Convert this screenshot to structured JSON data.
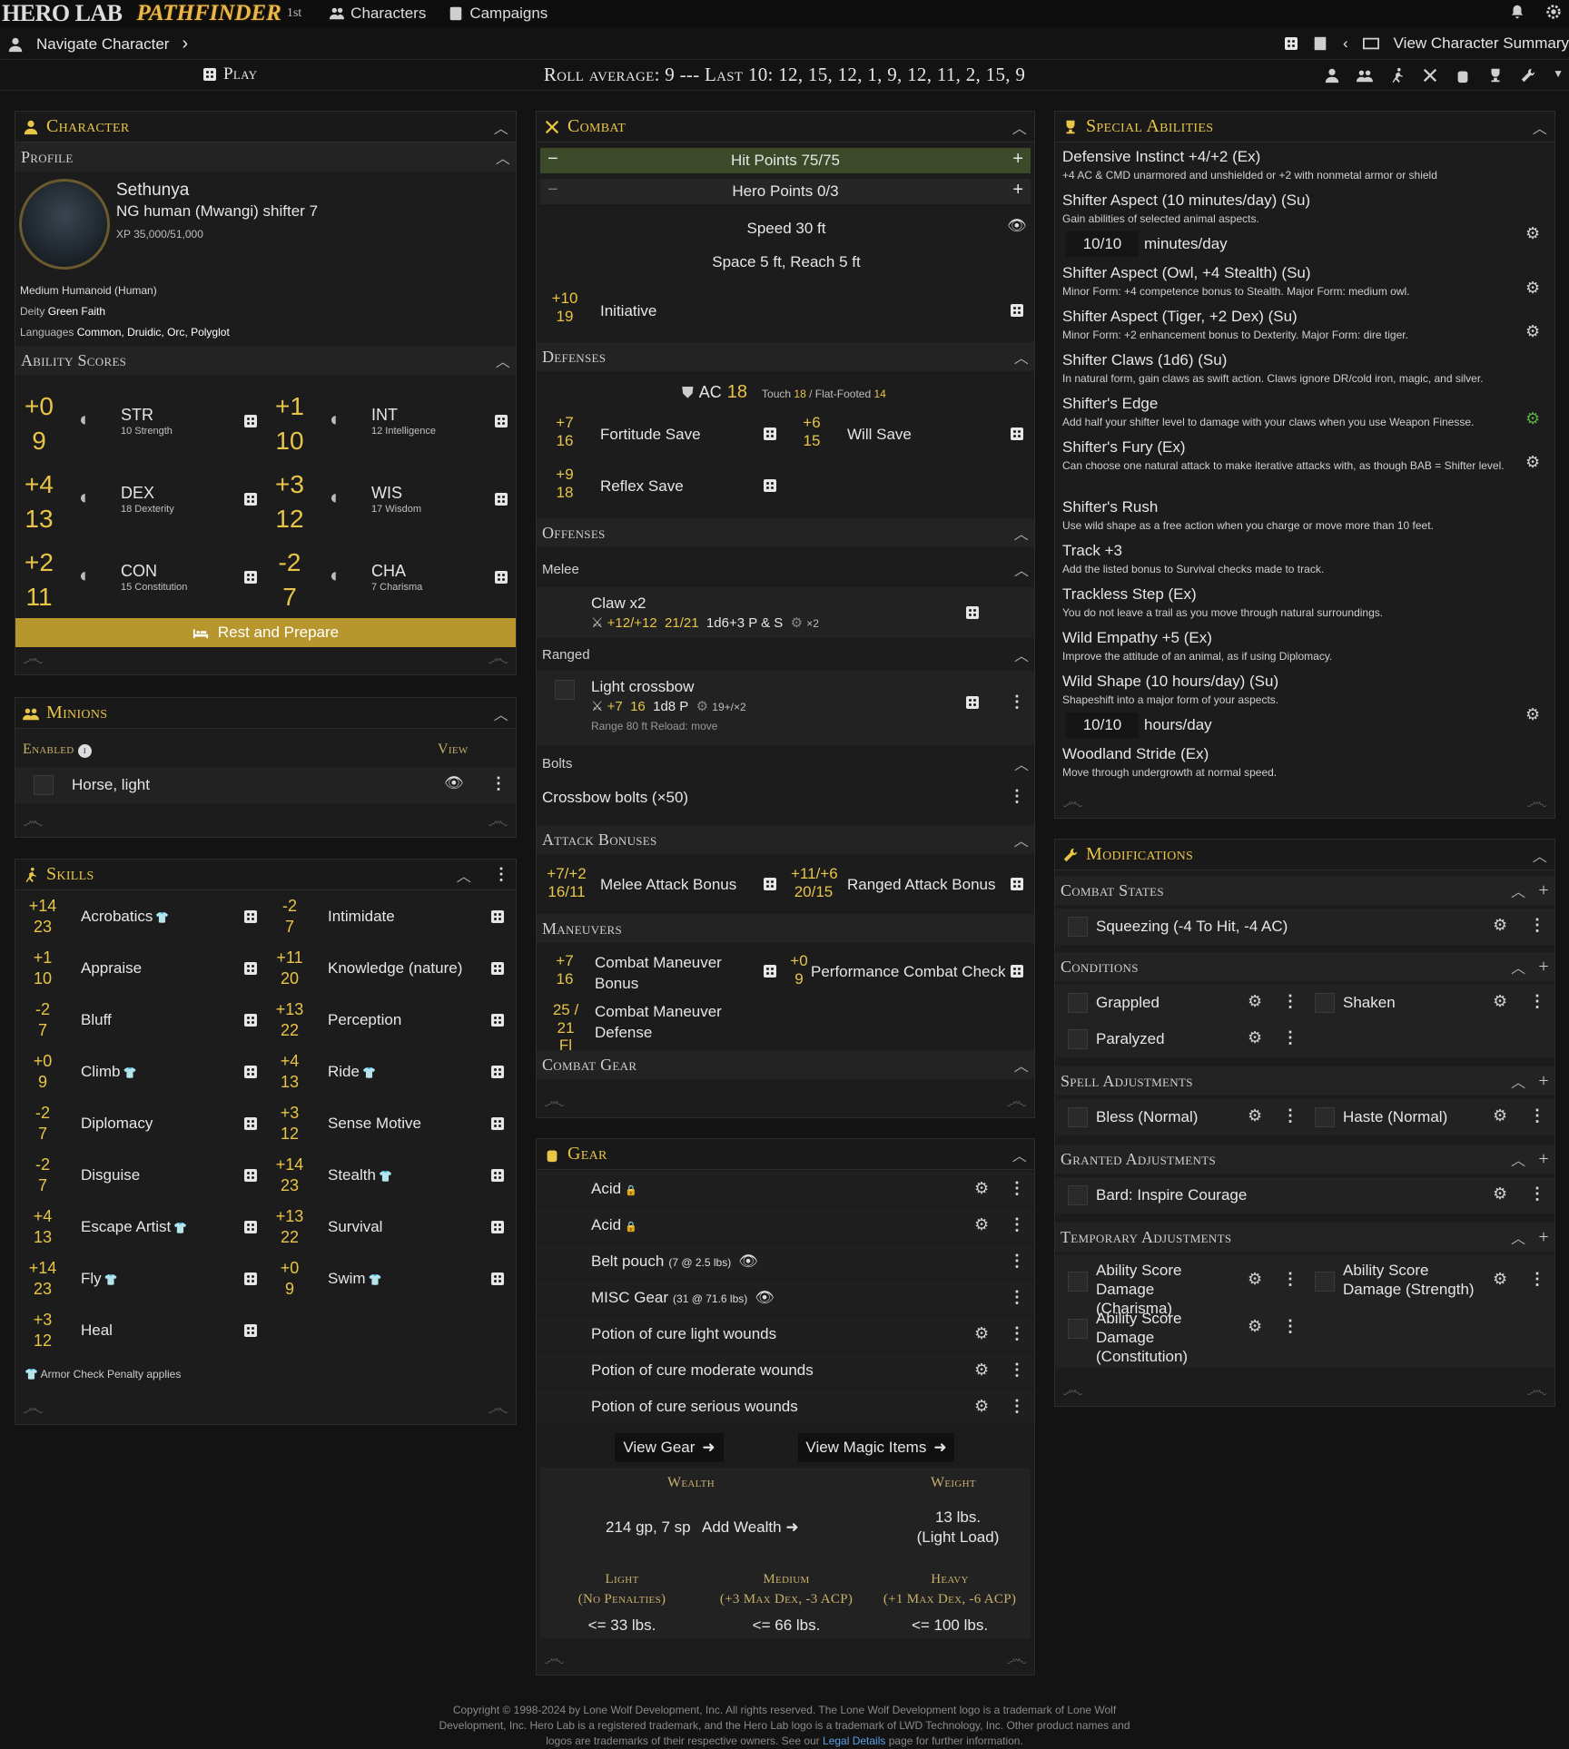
{
  "topbar": {
    "logo": "HERO LAB",
    "pathfinder": "PATHFINDER",
    "edition": "1st",
    "nav_characters": "Characters",
    "nav_campaigns": "Campaigns"
  },
  "bar2": {
    "navigate": "Navigate Character",
    "view_summary": "View Character Summary"
  },
  "bar3": {
    "play": "Play",
    "roll": "Roll average: 9 --- Last 10: 12, 15, 12, 1, 9, 12, 11, 2, 15, 9"
  },
  "character": {
    "title": "Character",
    "profile": "Profile",
    "name": "Sethunya",
    "desc": "NG human (Mwangi) shifter 7",
    "xp": "XP 35,000/51,000",
    "size": "Medium Humanoid (Human)",
    "deity_label": "Deity",
    "deity": "Green Faith",
    "lang_label": "Languages",
    "languages": "Common, Druidic, Orc, Polyglot",
    "ability_title": "Ability Scores",
    "abilities": [
      {
        "mod": "+0",
        "score": "9",
        "abbr": "STR",
        "full": "10 Strength"
      },
      {
        "mod": "+1",
        "score": "10",
        "abbr": "INT",
        "full": "12 Intelligence"
      },
      {
        "mod": "+4",
        "score": "13",
        "abbr": "DEX",
        "full": "18 Dexterity"
      },
      {
        "mod": "+3",
        "score": "12",
        "abbr": "WIS",
        "full": "17 Wisdom"
      },
      {
        "mod": "+2",
        "score": "11",
        "abbr": "CON",
        "full": "15 Constitution"
      },
      {
        "mod": "-2",
        "score": "7",
        "abbr": "CHA",
        "full": "7 Charisma"
      }
    ],
    "rest": "Rest and Prepare"
  },
  "minions": {
    "title": "Minions",
    "enabled": "Enabled",
    "view": "View",
    "item": "Horse, light"
  },
  "skills": {
    "title": "Skills",
    "acp_note": "Armor Check Penalty applies",
    "left": [
      {
        "mod": "+14",
        "total": "23",
        "name": "Acrobatics",
        "acp": true
      },
      {
        "mod": "+1",
        "total": "10",
        "name": "Appraise",
        "acp": false
      },
      {
        "mod": "-2",
        "total": "7",
        "name": "Bluff",
        "acp": false
      },
      {
        "mod": "+0",
        "total": "9",
        "name": "Climb",
        "acp": true
      },
      {
        "mod": "-2",
        "total": "7",
        "name": "Diplomacy",
        "acp": false
      },
      {
        "mod": "-2",
        "total": "7",
        "name": "Disguise",
        "acp": false
      },
      {
        "mod": "+4",
        "total": "13",
        "name": "Escape Artist",
        "acp": true
      },
      {
        "mod": "+14",
        "total": "23",
        "name": "Fly",
        "acp": true
      },
      {
        "mod": "+3",
        "total": "12",
        "name": "Heal",
        "acp": false
      }
    ],
    "right": [
      {
        "mod": "-2",
        "total": "7",
        "name": "Intimidate",
        "acp": false
      },
      {
        "mod": "+11",
        "total": "20",
        "name": "Knowledge (nature)",
        "acp": false
      },
      {
        "mod": "+13",
        "total": "22",
        "name": "Perception",
        "acp": false
      },
      {
        "mod": "+4",
        "total": "13",
        "name": "Ride",
        "acp": true
      },
      {
        "mod": "+3",
        "total": "12",
        "name": "Sense Motive",
        "acp": false
      },
      {
        "mod": "+14",
        "total": "23",
        "name": "Stealth",
        "acp": true
      },
      {
        "mod": "+13",
        "total": "22",
        "name": "Survival",
        "acp": false
      },
      {
        "mod": "+0",
        "total": "9",
        "name": "Swim",
        "acp": true
      }
    ]
  },
  "combat": {
    "title": "Combat",
    "hp": "Hit Points 75/75",
    "hero": "Hero Points 0/3",
    "speed": "Speed 30 ft",
    "space": "Space 5 ft, Reach 5 ft",
    "init_mod": "+10",
    "init_total": "19",
    "init_label": "Initiative",
    "defenses_title": "Defenses",
    "ac_label": "AC",
    "ac": "18",
    "touch_label": "Touch",
    "touch": "18",
    "ff_label": "/ Flat-Footed",
    "ff": "14",
    "fort": {
      "mod": "+7",
      "total": "16",
      "label": "Fortitude Save"
    },
    "will": {
      "mod": "+6",
      "total": "15",
      "label": "Will Save"
    },
    "reflex": {
      "mod": "+9",
      "total": "18",
      "label": "Reflex Save"
    },
    "offenses_title": "Offenses",
    "melee_title": "Melee",
    "claw": {
      "name": "Claw x2",
      "attack": "+12/+12",
      "uses": "21/21",
      "dmg": "1d6+3 P & S",
      "crit": "×2"
    },
    "ranged_title": "Ranged",
    "crossbow": {
      "name": "Light crossbow",
      "attack": "+7",
      "total": "16",
      "dmg": "1d8 P",
      "crit": "19+/×2",
      "range": "Range 80 ft Reload: move"
    },
    "bolts_title": "Bolts",
    "bolts": "Crossbow bolts (×50)",
    "attack_title": "Attack Bonuses",
    "melee_ab": {
      "mod": "+7/+2",
      "total": "16/11",
      "label": "Melee Attack Bonus"
    },
    "ranged_ab": {
      "mod": "+11/+6",
      "total": "20/15",
      "label": "Ranged Attack Bonus"
    },
    "maneuvers_title": "Maneuvers",
    "cmb": {
      "mod": "+7",
      "total": "16",
      "label": "Combat Maneuver Bonus"
    },
    "pcc": {
      "mod": "+0",
      "total": "9",
      "label": "Performance Combat Check"
    },
    "cmd": {
      "mod": "25 / 21",
      "total": "Fl",
      "label": "Combat Maneuver Defense"
    },
    "combat_gear_title": "Combat Gear"
  },
  "gear": {
    "title": "Gear",
    "items": [
      {
        "name": "Acid",
        "extra": ""
      },
      {
        "name": "Acid",
        "extra": ""
      },
      {
        "name": "Belt pouch",
        "extra": "(7 @ 2.5 lbs)"
      },
      {
        "name": "MISC Gear",
        "extra": "(31 @ 71.6 lbs)"
      },
      {
        "name": "Potion of cure light wounds",
        "extra": ""
      },
      {
        "name": "Potion of cure moderate wounds",
        "extra": ""
      },
      {
        "name": "Potion of cure serious wounds",
        "extra": ""
      }
    ],
    "view_gear": "View Gear",
    "view_magic": "View Magic Items",
    "wealth_label": "Wealth",
    "weight_label": "Weight",
    "wealth": "214 gp, 7 sp",
    "add_wealth": "Add Wealth",
    "weight": "13 lbs.",
    "load": "(Light Load)",
    "light": "Light",
    "light_sub": "(No Penalties)",
    "medium": "Medium",
    "medium_sub": "(+3 Max Dex, -3 ACP)",
    "heavy": "Heavy",
    "heavy_sub": "(+1 Max Dex, -6 ACP)",
    "light_val": "<= 33 lbs.",
    "medium_val": "<= 66 lbs.",
    "heavy_val": "<= 100 lbs."
  },
  "special": {
    "title": "Special Abilities",
    "items": [
      {
        "name": "Defensive Instinct +4/+2 (Ex)",
        "desc": "+4 AC & CMD unarmored and unshielded or +2 with nonmetal armor or shield"
      },
      {
        "name": "Shifter Aspect (10 minutes/day) (Su)",
        "desc": "Gain abilities of selected animal aspects.",
        "counter": "10/10",
        "unit": "minutes/day"
      },
      {
        "name": "Shifter Aspect (Owl, +4 Stealth) (Su)",
        "desc": "Minor Form: +4 competence bonus to Stealth. Major Form: medium owl."
      },
      {
        "name": "Shifter Aspect (Tiger, +2 Dex) (Su)",
        "desc": "Minor Form: +2 enhancement bonus to Dexterity. Major Form: dire tiger."
      },
      {
        "name": "Shifter Claws (1d6) (Su)",
        "desc": "In natural form, gain claws as swift action. Claws ignore DR/cold iron, magic, and silver."
      },
      {
        "name": "Shifter's Edge",
        "desc": "Add half your shifter level to damage with your claws when you use Weapon Finesse."
      },
      {
        "name": "Shifter's Fury (Ex)",
        "desc": "Can choose one natural attack to make iterative attacks with, as though BAB = Shifter level."
      },
      {
        "name": "Shifter's Rush",
        "desc": "Use wild shape as a free action when you charge or move more than 10 feet."
      },
      {
        "name": "Track +3",
        "desc": "Add the listed bonus to Survival checks made to track."
      },
      {
        "name": "Trackless Step (Ex)",
        "desc": "You do not leave a trail as you move through natural surroundings."
      },
      {
        "name": "Wild Empathy +5 (Ex)",
        "desc": "Improve the attitude of an animal, as if using Diplomacy."
      },
      {
        "name": "Wild Shape (10 hours/day) (Su)",
        "desc": "Shapeshift into a major form of your aspects.",
        "counter": "10/10",
        "unit": "hours/day"
      },
      {
        "name": "Woodland Stride (Ex)",
        "desc": "Move through undergrowth at normal speed."
      }
    ]
  },
  "mods": {
    "title": "Modifications",
    "combat_states": "Combat States",
    "squeezing": "Squeezing (-4 To Hit, -4 AC)",
    "conditions": "Conditions",
    "grappled": "Grappled",
    "shaken": "Shaken",
    "paralyzed": "Paralyzed",
    "spell_adj": "Spell Adjustments",
    "bless": "Bless (Normal)",
    "haste": "Haste (Normal)",
    "granted_adj": "Granted Adjustments",
    "inspire": "Bard: Inspire Courage",
    "temp_adj": "Temporary Adjustments",
    "asd_cha": "Ability Score Damage (Charisma)",
    "asd_str": "Ability Score Damage (Strength)",
    "asd_con": "Ability Score Damage (Constitution)"
  },
  "footer": {
    "line1": "Copyright © 1998-2024 by Lone Wolf Development, Inc. All rights reserved. The Lone Wolf Development logo is a trademark of Lone Wolf",
    "line2": "Development, Inc. Hero Lab is a registered trademark, and the Hero Lab logo is a trademark of LWD Technology, Inc. Other product names and",
    "line3a": "logos are trademarks of their respective owners. See our",
    "legal": "Legal Details",
    "line3b": "page for further information."
  },
  "colors": {
    "accent": "#e8c547",
    "bg": "#131313",
    "panel": "#1c1c1c",
    "hp_bar": "#3d4a2a",
    "rest_button": "#b8962e"
  }
}
